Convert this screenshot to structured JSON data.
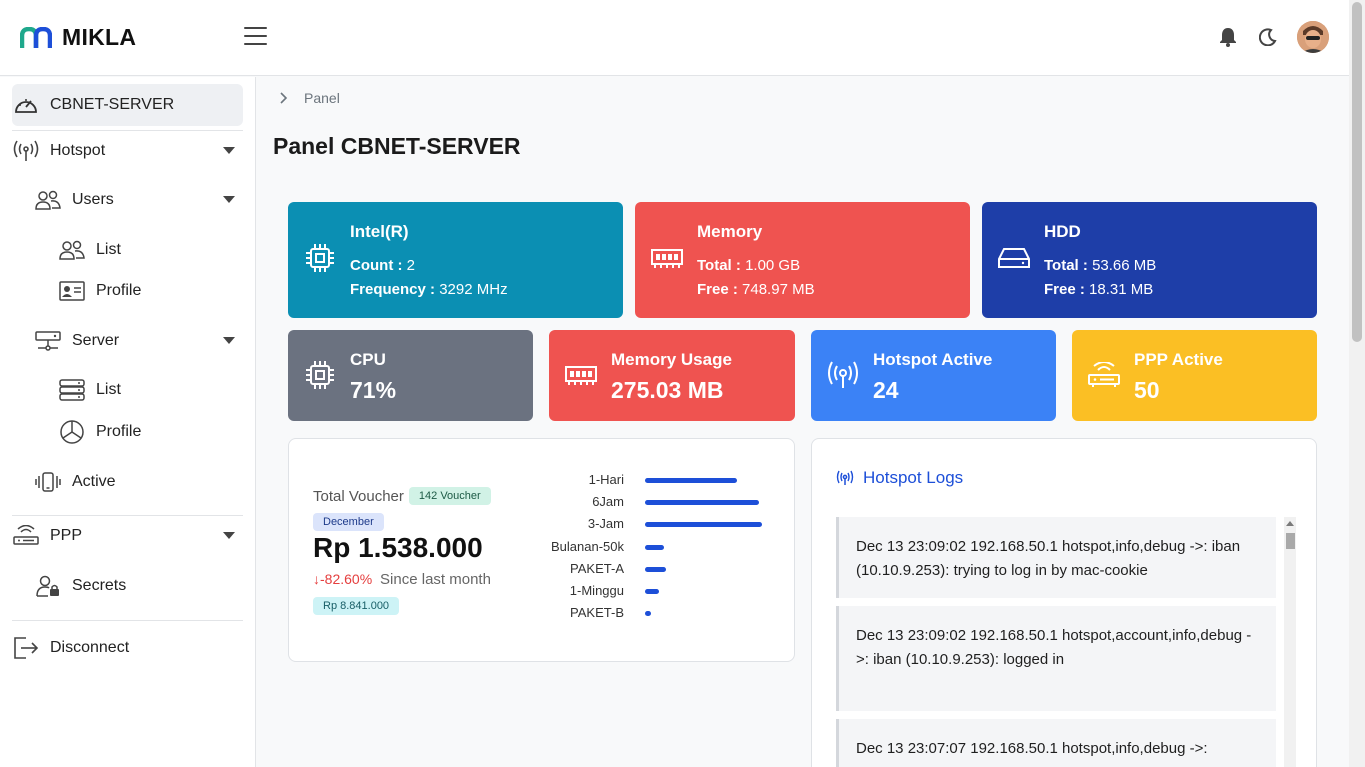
{
  "app": {
    "name": "MIKLA"
  },
  "colors": {
    "teal": "#0b8fb3",
    "red": "#ef5350",
    "navy": "#1e3ea8",
    "gray": "#6b7280",
    "blue": "#3b82f6",
    "yellow": "#fbbf24",
    "accent": "#1d4fd8"
  },
  "sidebar": {
    "router": "CBNET-SERVER",
    "hotspot": "Hotspot",
    "users": "Users",
    "users_list": "List",
    "users_profile": "Profile",
    "server": "Server",
    "server_list": "List",
    "server_profile": "Profile",
    "active": "Active",
    "ppp": "PPP",
    "secrets": "Secrets",
    "disconnect": "Disconnect"
  },
  "breadcrumb": {
    "item": "Panel"
  },
  "page": {
    "title": "Panel CBNET-SERVER"
  },
  "cards_top": {
    "cpu_info": {
      "title": "Intel(R)",
      "count_label": "Count :",
      "count": "2",
      "freq_label": "Frequency :",
      "freq": "3292 MHz",
      "icon": "cpu-icon"
    },
    "memory": {
      "title": "Memory",
      "total_label": "Total :",
      "total": "1.00 GB",
      "free_label": "Free :",
      "free": "748.97 MB",
      "icon": "memory-icon"
    },
    "hdd": {
      "title": "HDD",
      "total_label": "Total :",
      "total": "53.66 MB",
      "free_label": "Free :",
      "free": "18.31 MB",
      "icon": "hdd-icon"
    }
  },
  "cards_bottom": {
    "cpu": {
      "title": "CPU",
      "value": "71%",
      "icon": "cpu-icon"
    },
    "mem_usage": {
      "title": "Memory Usage",
      "value": "275.03 MB",
      "icon": "memory-icon"
    },
    "hotspot_active": {
      "title": "Hotspot Active",
      "value": "24",
      "icon": "antenna-icon"
    },
    "ppp_active": {
      "title": "PPP Active",
      "value": "50",
      "icon": "router-icon"
    }
  },
  "voucher": {
    "label": "Total Voucher",
    "count_badge": "142 Voucher",
    "month_badge": "December",
    "amount": "Rp 1.538.000",
    "change": "↓-82.60%",
    "change_text": "Since last month",
    "prev_badge": "Rp 8.841.000"
  },
  "chart_data": {
    "type": "bar",
    "orientation": "horizontal",
    "categories": [
      "1-Hari",
      "6Jam",
      "3-Jam",
      "Bulanan-50k",
      "PAKET-A",
      "1-Minggu",
      "PAKET-B"
    ],
    "values": [
      92,
      114,
      117,
      19,
      21,
      14,
      6
    ],
    "value_scale": "relative (no axis shown)",
    "xlabel": "",
    "ylabel": "",
    "grid": false,
    "legend": "none"
  },
  "logs": {
    "title": "Hotspot Logs",
    "items": [
      "Dec 13 23:09:02 192.168.50.1 hotspot,info,debug ->: iban (10.10.9.253): trying to log in by mac-cookie",
      "Dec 13 23:09:02 192.168.50.1 hotspot,account,info,debug ->: iban (10.10.9.253): logged in",
      "Dec 13 23:07:07 192.168.50.1 hotspot,info,debug ->:"
    ]
  }
}
